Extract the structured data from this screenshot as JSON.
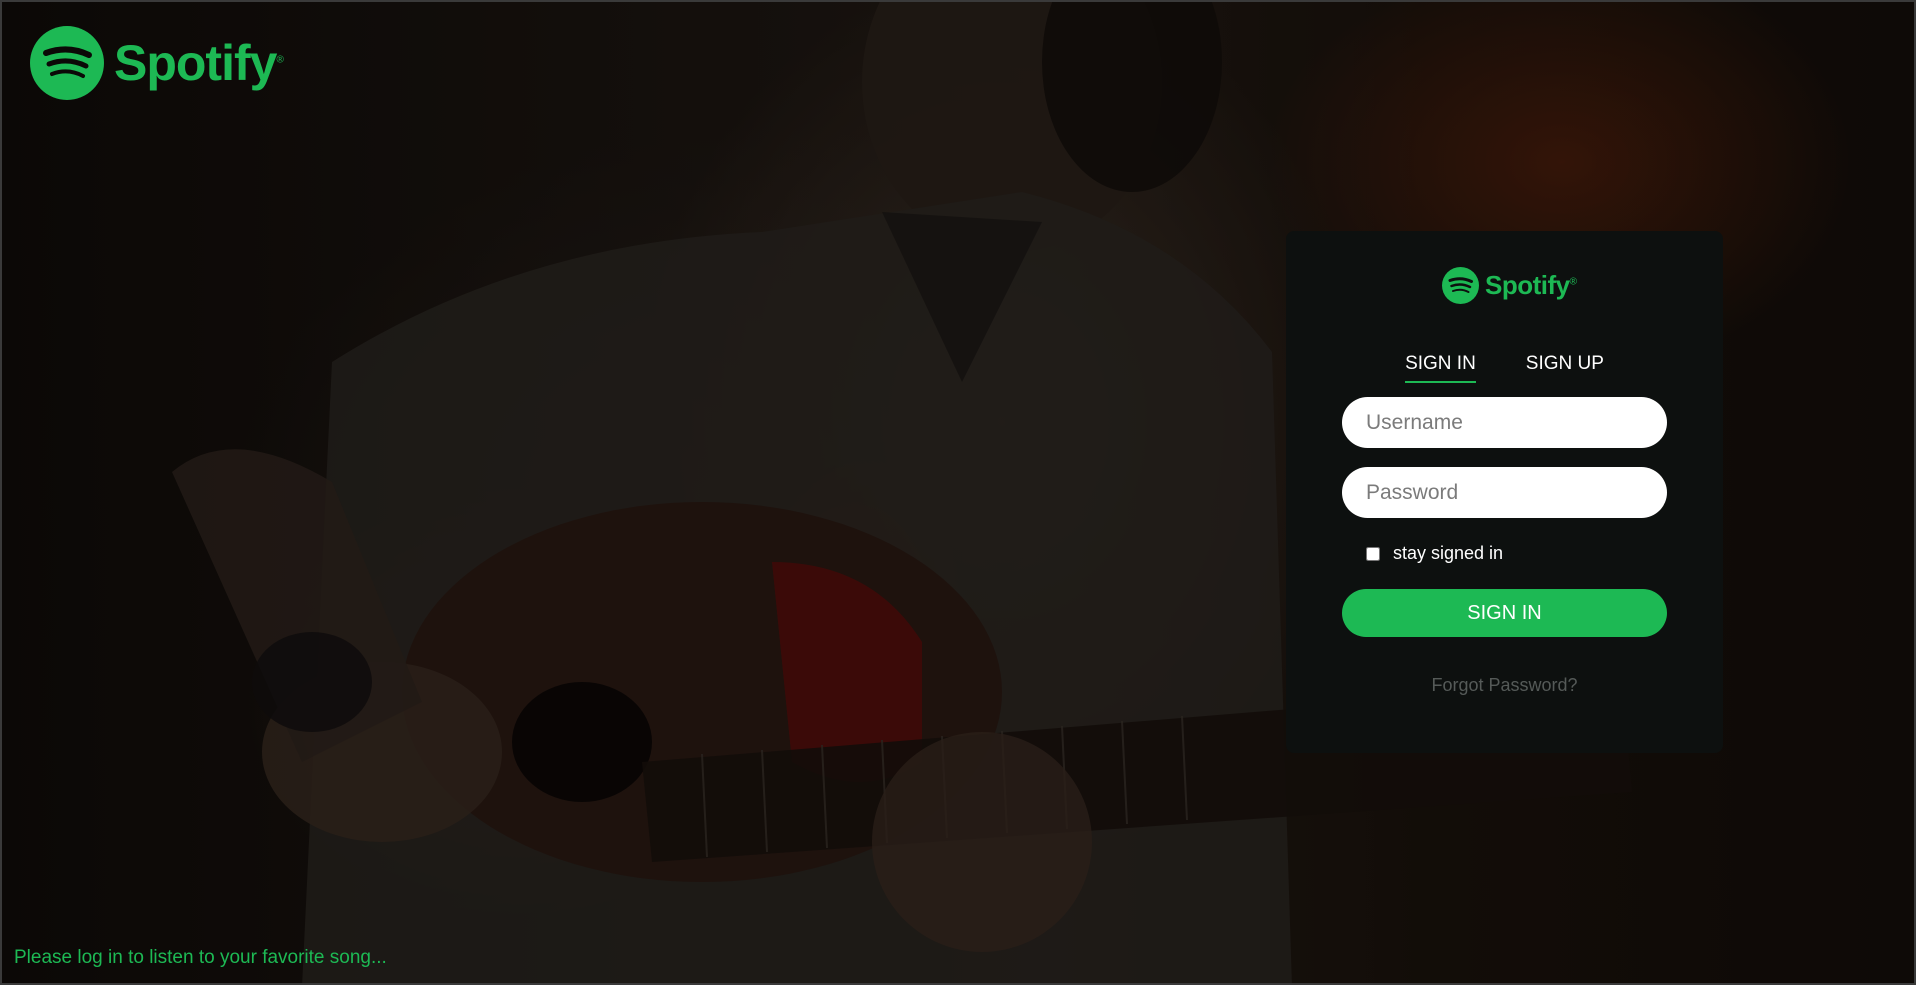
{
  "brand": {
    "name": "Spotify",
    "trademark": "®",
    "color": "#1db954"
  },
  "card": {
    "logo_name": "Spotify",
    "logo_trademark": "®",
    "tabs": [
      {
        "label": "SIGN IN",
        "active": true
      },
      {
        "label": "SIGN UP",
        "active": false
      }
    ],
    "username_placeholder": "Username",
    "password_placeholder": "Password",
    "remember_label": "stay signed in",
    "remember_checked": false,
    "submit_label": "SIGN IN",
    "forgot_label": "Forgot Password?"
  },
  "footer": {
    "message": "Please log in to listen to your favorite song..."
  },
  "icons": {
    "brand_icon": "spotify-logo-icon",
    "card_icon": "spotify-logo-icon"
  },
  "colors": {
    "accent": "#1db954",
    "card_bg": "#0d100f",
    "forgot": "#555a58"
  }
}
